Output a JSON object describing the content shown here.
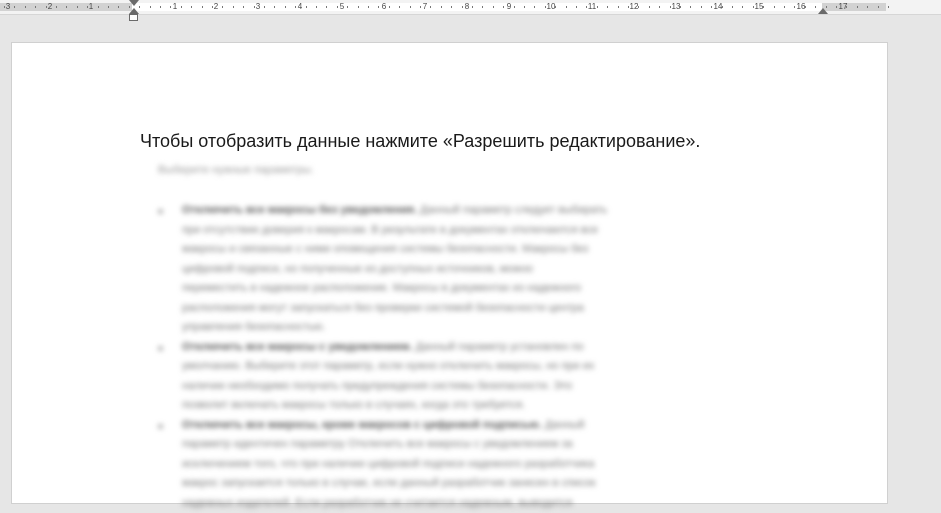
{
  "ruler": {
    "left_labels": [
      "3",
      "2",
      "1"
    ],
    "right_labels": [
      "1",
      "2",
      "3",
      "4",
      "5",
      "6",
      "7",
      "8",
      "9",
      "10",
      "11",
      "12",
      "13",
      "14",
      "15",
      "16",
      "17"
    ]
  },
  "document": {
    "headline": "Чтобы отобразить данные нажмите «Разрешить редактирование».",
    "subtitle": "Выберите нужные параметры.",
    "bullets": [
      {
        "lead": "Отключить все макросы без уведомления.",
        "lines": [
          "Данный параметр следует выбирать",
          "при отсутствии доверия к макросам. В результате в документах отключаются все",
          "макросы и связанные с ними оповещения системы безопасности. Макросы без",
          "цифровой подписи, но полученные из доступных источников, можно",
          "переместить в надежное расположение. Макросы в документах из надежного",
          "расположения могут запускаться без проверки системой безопасности центра",
          "управления безопасностью."
        ]
      },
      {
        "lead": "Отключить все макросы с уведомлением.",
        "lines": [
          "Данный параметр установлен по",
          "умолчанию. Выберите этот параметр, если нужно отключить макросы, но при их",
          "наличии необходимо получать предупреждения системы безопасности. Это",
          "позволит включать макросы только в случаях, когда это требуется."
        ]
      },
      {
        "lead": "Отключить все макросы, кроме макросов с цифровой подписью.",
        "lines": [
          "Данный",
          "параметр идентичен параметру Отключить все макросы с уведомлением за",
          "исключением того, что при наличии цифровой подписи надежного разработчика",
          "макрос запускается только в случае, если данный разработчик занесен в список",
          "надежных издателей. Если разработчик не считается надежным, выводится"
        ]
      }
    ]
  }
}
